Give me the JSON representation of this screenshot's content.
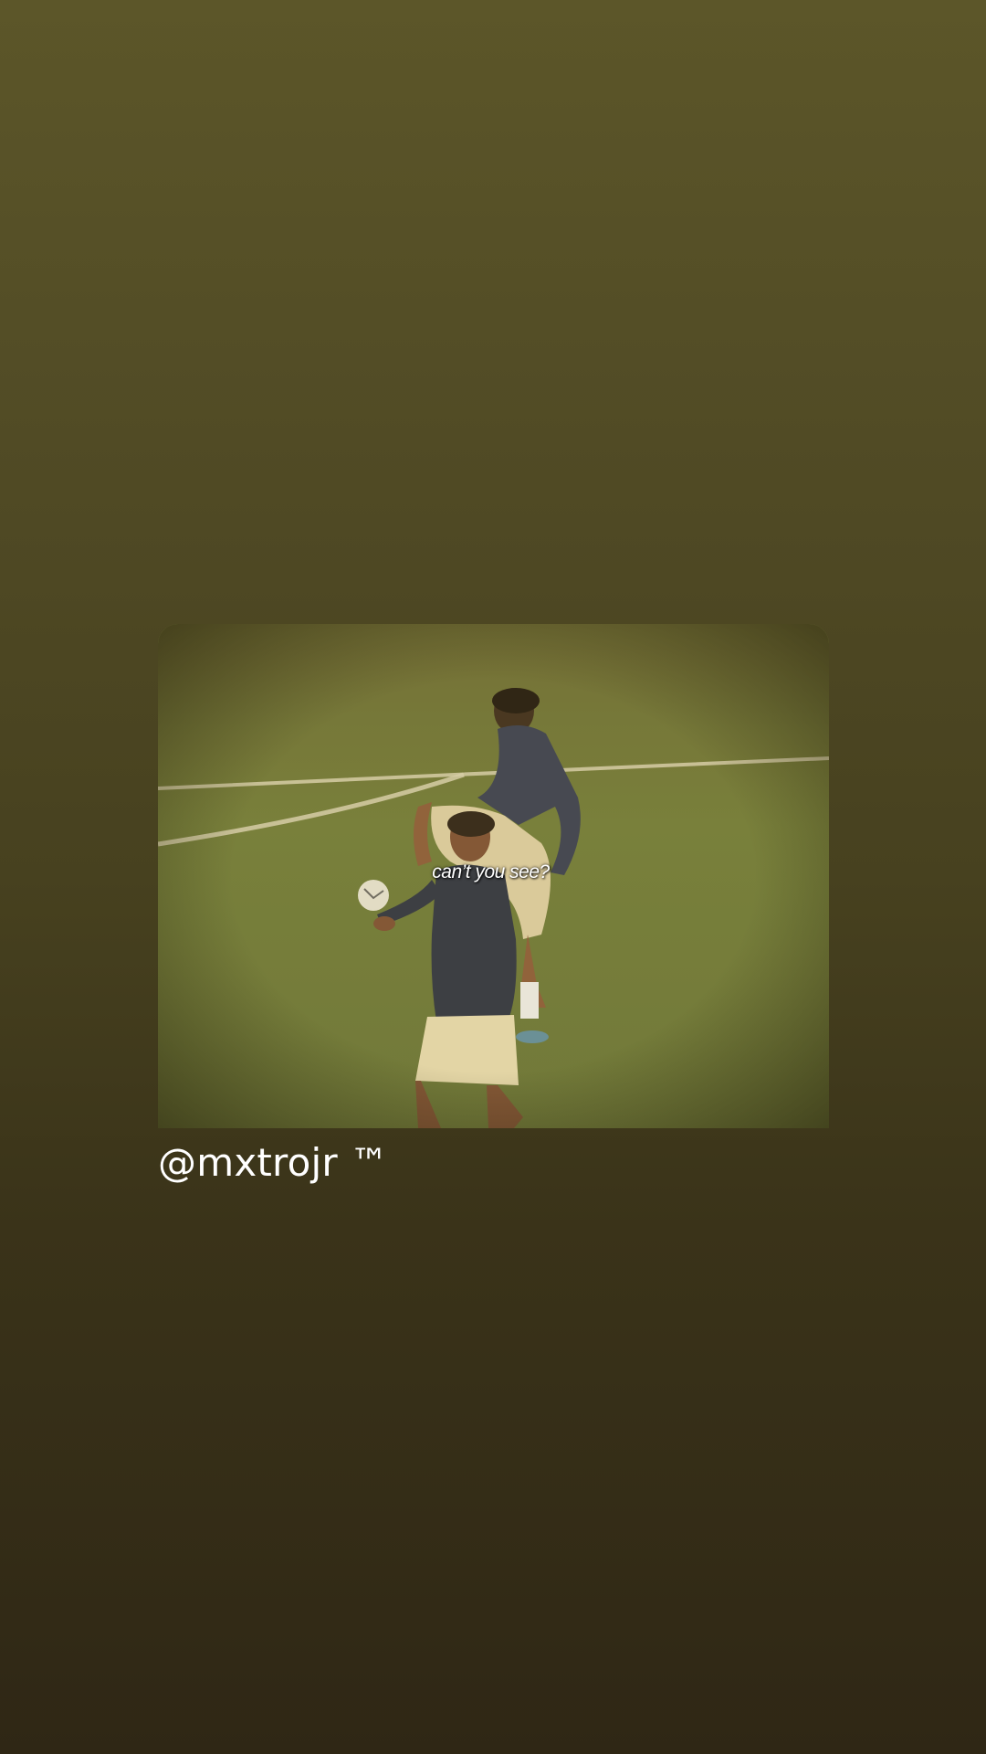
{
  "story": {
    "media": {
      "caption": "can’t you see?",
      "description_icon": "video-still-icon"
    },
    "username_tag": "@mxtrojr ™"
  }
}
